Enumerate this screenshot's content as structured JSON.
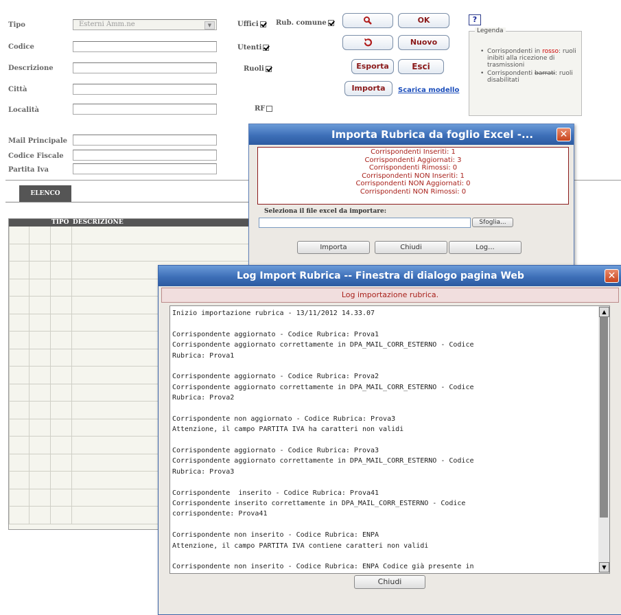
{
  "form": {
    "tipo_label": "Tipo",
    "tipo_value": "Esterni Amm.ne",
    "codice_label": "Codice",
    "descrizione_label": "Descrizione",
    "citta_label": "Città",
    "localita_label": "Località",
    "mail_label": "Mail Principale",
    "cf_label": "Codice Fiscale",
    "piva_label": "Partita Iva"
  },
  "filters": {
    "uffici": "Uffici",
    "rub_comune": "Rub. comune",
    "utenti": "Utenti",
    "ruoli": "Ruoli",
    "rf": "RF"
  },
  "buttons": {
    "ok": "OK",
    "nuovo": "Nuovo",
    "esporta": "Esporta",
    "esci": "Esci",
    "importa": "Importa",
    "scarica_modello": "Scarica modello"
  },
  "legend": {
    "title": "Legenda",
    "item1_a": "Corrispondenti in",
    "item1_red": "rosso",
    "item1_b": ": ruoli inibiti alla ricezione di trasmissioni",
    "item2_a": "Corrispondenti",
    "item2_strike": "barrati",
    "item2_b": ": ruoli disabilitati"
  },
  "list": {
    "tab": "ELENCO",
    "col_tipo": "TIPO",
    "col_descrizione": "DESCRIZIONE"
  },
  "import_dialog": {
    "title": "Importa Rubrica da foglio Excel -...",
    "results": [
      "Corrispondenti Inseriti: 1",
      "Corrispondenti Aggiornati: 3",
      "Corrispondenti Rimossi: 0",
      "Corrispondenti NON Inseriti: 1",
      "Corrispondenti NON Aggiornati: 0",
      "Corrispondenti NON Rimossi: 0"
    ],
    "file_label": "Seleziona il file excel da importare:",
    "sfoglia": "Sfoglia...",
    "importa": "Importa",
    "chiudi": "Chiudi",
    "log": "Log..."
  },
  "log_dialog": {
    "title": "Log Import Rubrica -- Finestra di dialogo pagina Web",
    "header": "Log importazione rubrica.",
    "lines": [
      "Inizio importazione rubrica - 13/11/2012 14.33.07",
      "",
      "Corrispondente aggiornato - Codice Rubrica: Prova1",
      "Corrispondente aggiornato correttamente in DPA_MAIL_CORR_ESTERNO - Codice",
      "Rubrica: Prova1",
      "",
      "Corrispondente aggiornato - Codice Rubrica: Prova2",
      "Corrispondente aggiornato correttamente in DPA_MAIL_CORR_ESTERNO - Codice",
      "Rubrica: Prova2",
      "",
      "Corrispondente non aggiornato - Codice Rubrica: Prova3",
      "Attenzione, il campo PARTITA IVA ha caratteri non validi",
      "",
      "Corrispondente aggiornato - Codice Rubrica: Prova3",
      "Corrispondente aggiornato correttamente in DPA_MAIL_CORR_ESTERNO - Codice",
      "Rubrica: Prova3",
      "",
      "Corrispondente  inserito - Codice Rubrica: Prova41",
      "Corrispondente inserito correttamente in DPA_MAIL_CORR_ESTERNO - Codice",
      "corrispondente: Prova41",
      "",
      "Corrispondente non inserito - Codice Rubrica: ENPA",
      "Attenzione, il campo PARTITA IVA contiene caratteri non validi",
      "",
      "Corrispondente non inserito - Codice Rubrica: ENPA Codice già presente in"
    ],
    "chiudi": "Chiudi"
  }
}
